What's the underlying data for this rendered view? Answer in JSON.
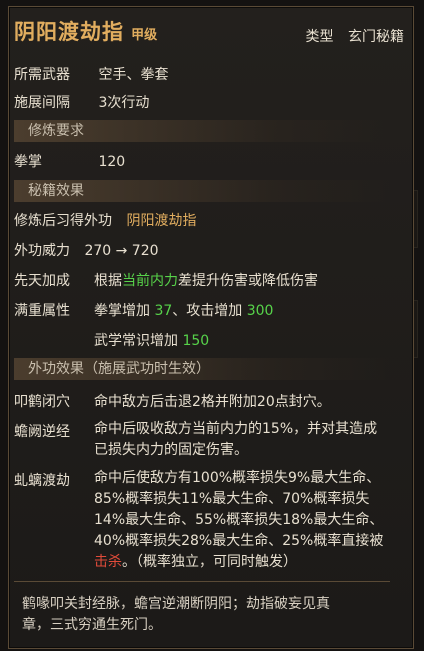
{
  "header": {
    "title": "阴阳渡劫指",
    "grade": "甲级",
    "type_label": "类型",
    "type_value": "玄门秘籍"
  },
  "info": {
    "weapon_label": "所需武器",
    "weapon_value": "空手、拳套",
    "interval_label": "施展间隔",
    "interval_value": "3次行动"
  },
  "requirements": {
    "section": "修炼要求",
    "skill_label": "拳掌",
    "skill_value": "120"
  },
  "effects": {
    "section": "秘籍效果",
    "learn_label": "修炼后习得外功",
    "learn_value": "阴阳渡劫指",
    "power_label": "外功威力",
    "power_value": "270 → 720",
    "innate_label": "先天加成",
    "innate_pre": "根据",
    "innate_highlight": "当前内力",
    "innate_post": "差提升伤害或降低伤害",
    "full_label": "满重属性",
    "full_1_pre": "拳掌增加 ",
    "full_1_val": "37",
    "full_1_mid": "、攻击增加 ",
    "full_1_val2": "300",
    "full_2_pre": "武学常识增加 ",
    "full_2_val": "150"
  },
  "external": {
    "section": "外功效果（施展武功时生效）",
    "e1_label": "叩鹤闭穴",
    "e1_text": "命中敌方后击退2格并附加20点封穴。",
    "e2_label": "蟾阙逆经",
    "e2_line1": "命中后吸收敌方当前内力的15%，并对其造成",
    "e2_line2": "已损失内力的固定伤害。",
    "e3_label": "虬螭渡劫",
    "e3_line1": "命中后使敌方有100%概率损失9%最大生命、",
    "e3_line2": "85%概率损失11%最大生命、70%概率损失",
    "e3_line3": "14%最大生命、55%概率损失18%最大生命、",
    "e3_line4": "40%概率损失28%最大生命、25%概率直接被",
    "e3_kill": "击杀",
    "e3_tail": "。（概率独立，可同时触发）"
  },
  "poem": {
    "line1": "鹤喙叩关封经脉，蟾宫逆潮断阴阳；劫指破妄见真",
    "line2": "章，三式穷通生死门。"
  },
  "colors": {
    "gold": "#e1ad5f",
    "green": "#57d34a",
    "red": "#e14b3a"
  }
}
